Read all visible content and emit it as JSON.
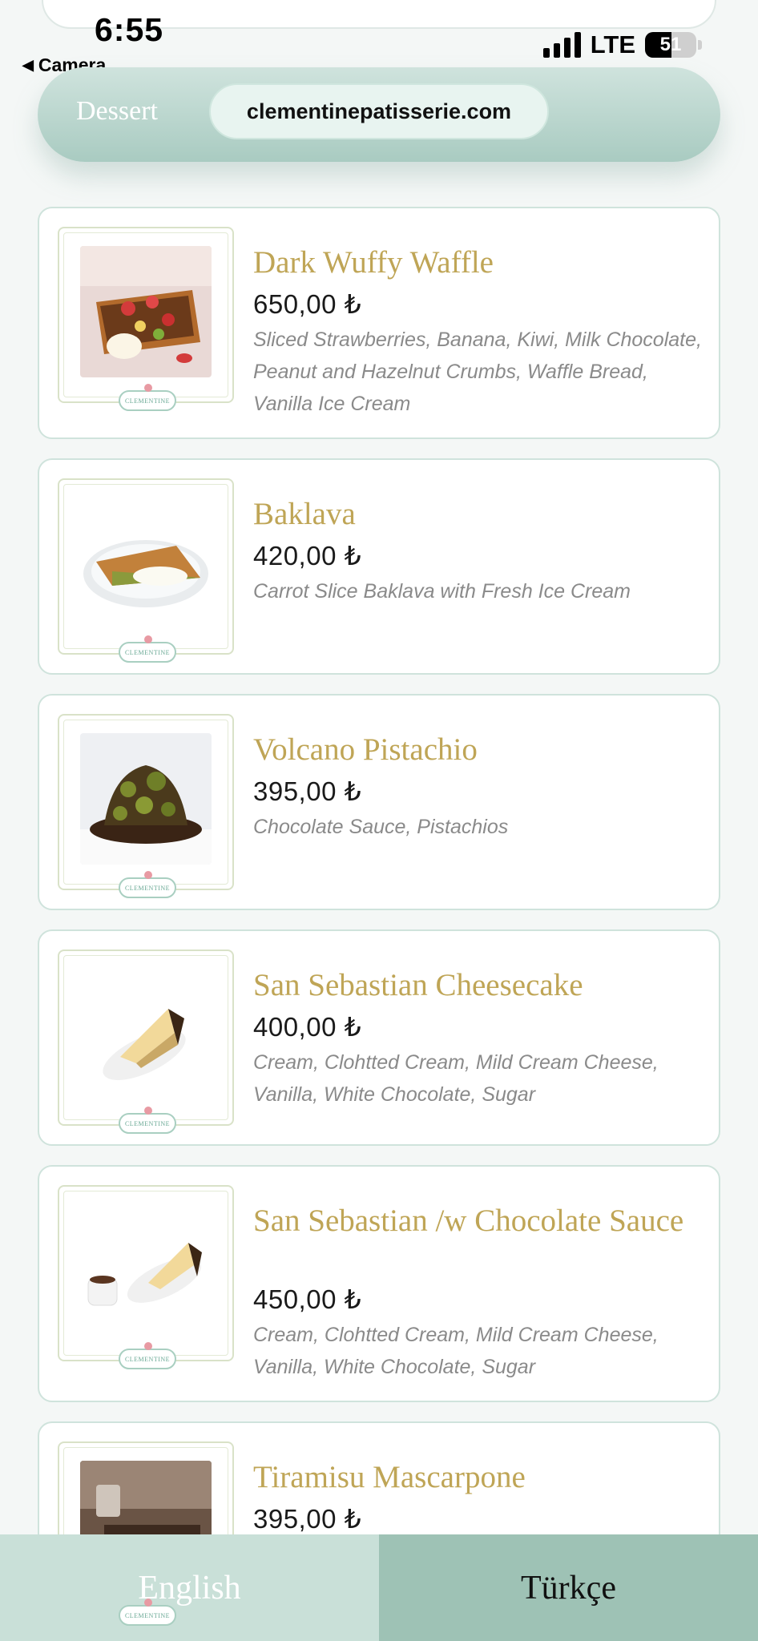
{
  "status_bar": {
    "time": "6:55",
    "back_label": "Camera",
    "network": "LTE",
    "battery": "51"
  },
  "header": {
    "category_title": "Dessert",
    "url": "clementinepatisserie.com"
  },
  "menu_items": [
    {
      "name": "Dark Wuffy Waffle",
      "price": "650,00 ₺",
      "description": "Sliced Strawberries, Banana, Kiwi, Milk Chocolate, Peanut and Hazelnut Crumbs, Waffle Bread, Vanilla Ice Cream",
      "logo": "CLEMENTINE"
    },
    {
      "name": "Baklava",
      "price": "420,00 ₺",
      "description": "Carrot Slice Baklava with Fresh Ice Cream",
      "logo": "CLEMENTINE"
    },
    {
      "name": "Volcano Pistachio",
      "price": "395,00 ₺",
      "description": "Chocolate Sauce, Pistachios",
      "logo": "CLEMENTINE"
    },
    {
      "name": "San Sebastian Cheesecake",
      "price": "400,00 ₺",
      "description": "Cream, Clohtted Cream, Mild Cream Cheese, Vanilla, White Chocolate, Sugar",
      "logo": "CLEMENTINE"
    },
    {
      "name": "San Sebastian /w Chocolate Sauce",
      "price": "450,00 ₺",
      "description": "Cream, Clohtted Cream, Mild Cream Cheese, Vanilla, White Chocolate, Sugar",
      "logo": "CLEMENTINE"
    },
    {
      "name": "Tiramisu Mascarpone",
      "price": "395,00 ₺",
      "description": "",
      "logo": "CLEMENTINE"
    }
  ],
  "language_bar": {
    "english": "English",
    "turkish": "Türkçe"
  },
  "colors": {
    "accent_mint": "#a9cbc1",
    "item_name_gold": "#bfa556",
    "description_gray": "#8a8a8a"
  }
}
